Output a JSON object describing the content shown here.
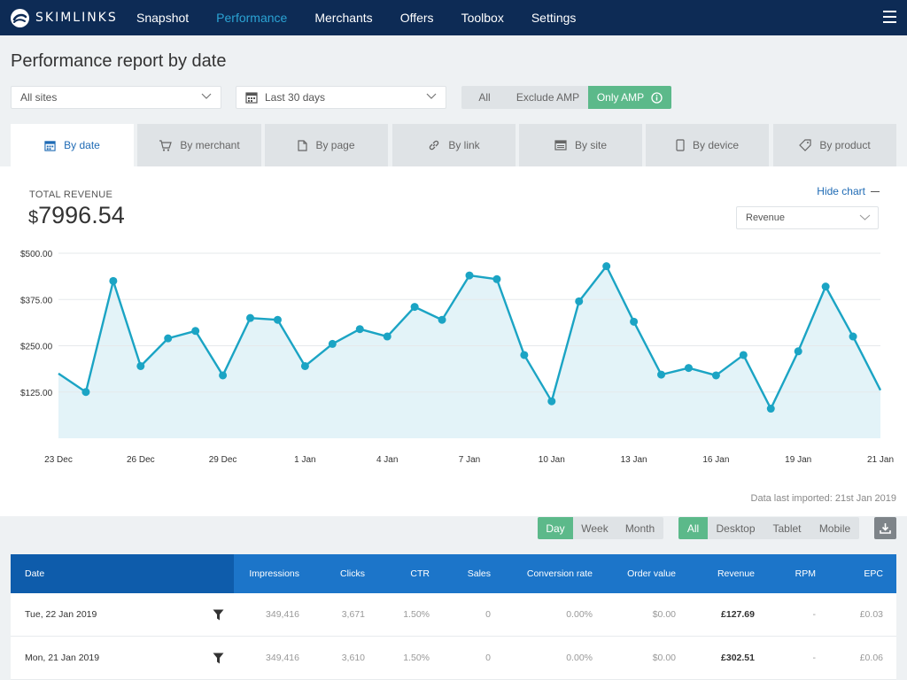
{
  "nav": {
    "brand": "SKIMLINKS",
    "items": [
      "Snapshot",
      "Performance",
      "Merchants",
      "Offers",
      "Toolbox",
      "Settings"
    ],
    "active": "Performance"
  },
  "page": {
    "title": "Performance report by date"
  },
  "filters": {
    "sites": "All sites",
    "range": "Last 30 days",
    "amp": {
      "all": "All",
      "exclude": "Exclude AMP",
      "only": "Only AMP",
      "selected": "Only AMP"
    }
  },
  "tabs": [
    {
      "label": "By date",
      "icon": "calendar-icon",
      "active": true
    },
    {
      "label": "By merchant",
      "icon": "cart-icon"
    },
    {
      "label": "By page",
      "icon": "page-icon"
    },
    {
      "label": "By link",
      "icon": "link-icon"
    },
    {
      "label": "By site",
      "icon": "site-icon"
    },
    {
      "label": "By device",
      "icon": "device-icon"
    },
    {
      "label": "By product",
      "icon": "tag-icon"
    }
  ],
  "summary": {
    "label": "TOTAL REVENUE",
    "currency": "$",
    "value": "7996.54",
    "hide_chart": "Hide chart",
    "metric": "Revenue"
  },
  "chart_data": {
    "type": "area",
    "title": "",
    "xlabel": "",
    "ylabel": "",
    "ylim": [
      0,
      500
    ],
    "y_ticks": [
      "$500.00",
      "$375.00",
      "$250.00",
      "$125.00"
    ],
    "y_tick_values": [
      500,
      375,
      250,
      125
    ],
    "x_tick_labels": [
      "23 Dec",
      "26 Dec",
      "29 Dec",
      "1 Jan",
      "4 Jan",
      "7 Jan",
      "10 Jan",
      "13 Jan",
      "16 Jan",
      "19 Jan",
      "21 Jan"
    ],
    "x_tick_index": [
      0,
      3,
      6,
      9,
      12,
      15,
      18,
      21,
      24,
      27,
      30
    ],
    "x": [
      "23 Dec",
      "24 Dec",
      "25 Dec",
      "26 Dec",
      "27 Dec",
      "28 Dec",
      "29 Dec",
      "30 Dec",
      "31 Dec",
      "1 Jan",
      "2 Jan",
      "3 Jan",
      "4 Jan",
      "5 Jan",
      "6 Jan",
      "7 Jan",
      "8 Jan",
      "9 Jan",
      "10 Jan",
      "11 Jan",
      "12 Jan",
      "13 Jan",
      "14 Jan",
      "15 Jan",
      "16 Jan",
      "17 Jan",
      "18 Jan",
      "19 Jan",
      "20 Jan",
      "21 Jan",
      "22 Jan"
    ],
    "values": [
      175,
      125,
      425,
      195,
      270,
      290,
      170,
      325,
      320,
      195,
      255,
      295,
      275,
      355,
      320,
      440,
      430,
      225,
      100,
      370,
      465,
      315,
      172,
      190,
      170,
      225,
      80,
      235,
      410,
      275,
      130
    ],
    "grid": true,
    "color": "#1ba4c4",
    "fill": "#e3f3f8"
  },
  "meta": {
    "imported": "Data last imported: 21st Jan 2019"
  },
  "granularity": {
    "options": [
      "Day",
      "Week",
      "Month"
    ],
    "selected": "Day"
  },
  "device": {
    "options": [
      "All",
      "Desktop",
      "Tablet",
      "Mobile"
    ],
    "selected": "All"
  },
  "table": {
    "columns": [
      "Date",
      "Impressions",
      "Clicks",
      "CTR",
      "Sales",
      "Conversion rate",
      "Order value",
      "Revenue",
      "RPM",
      "EPC"
    ],
    "rows": [
      [
        "Tue, 22 Jan 2019",
        "349,416",
        "3,671",
        "1.50%",
        "0",
        "0.00%",
        "$0.00",
        "£127.69",
        "-",
        "£0.03"
      ],
      [
        "Mon, 21 Jan 2019",
        "349,416",
        "3,610",
        "1.50%",
        "0",
        "0.00%",
        "$0.00",
        "£302.51",
        "-",
        "£0.06"
      ]
    ]
  }
}
